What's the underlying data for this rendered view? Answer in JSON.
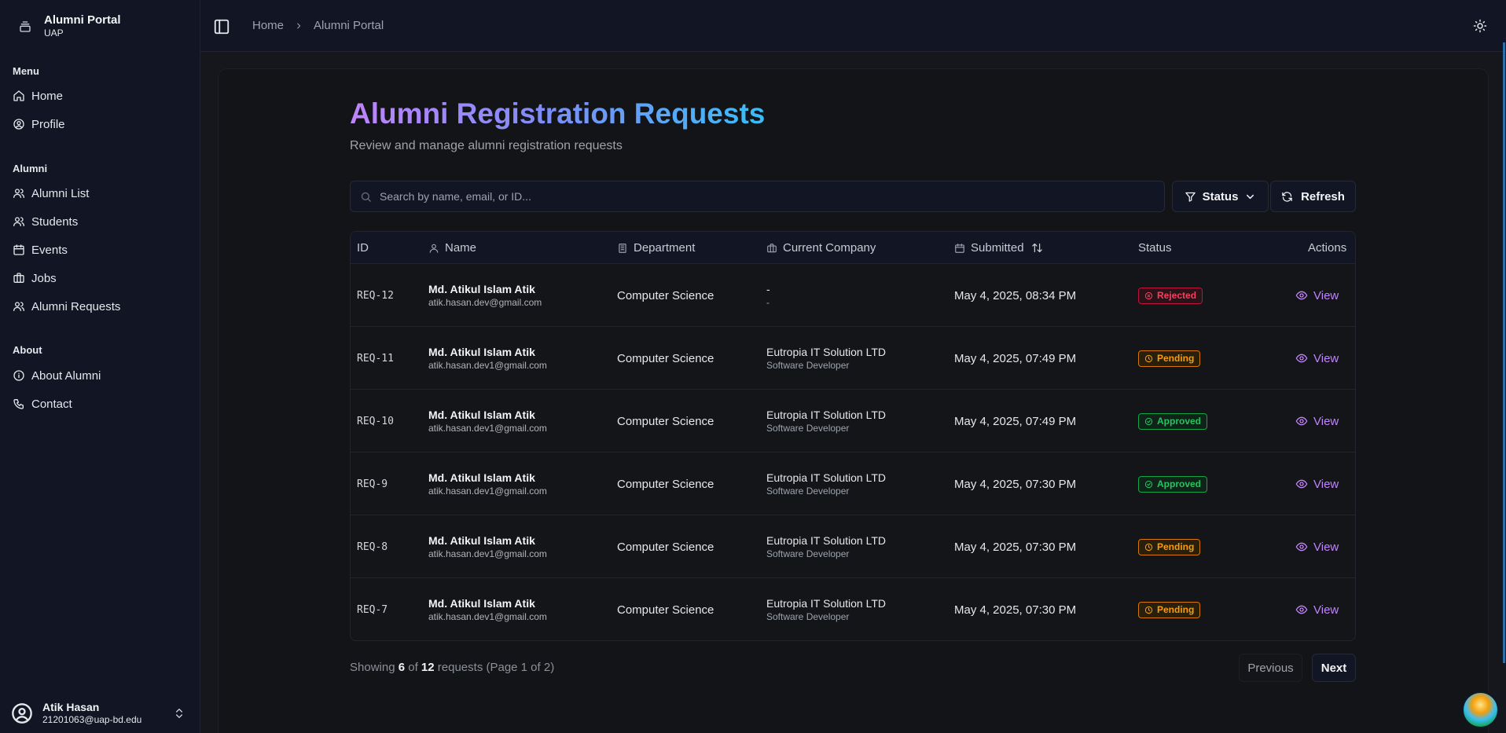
{
  "brand": {
    "title": "Alumni Portal",
    "subtitle": "UAP"
  },
  "sidebar": {
    "groups": [
      {
        "label": "Menu",
        "items": [
          {
            "label": "Home",
            "icon": "home-icon"
          },
          {
            "label": "Profile",
            "icon": "user-circle-icon"
          }
        ]
      },
      {
        "label": "Alumni",
        "items": [
          {
            "label": "Alumni List",
            "icon": "users-icon"
          },
          {
            "label": "Students",
            "icon": "users-icon"
          },
          {
            "label": "Events",
            "icon": "calendar-icon"
          },
          {
            "label": "Jobs",
            "icon": "briefcase-icon"
          },
          {
            "label": "Alumni Requests",
            "icon": "users-icon"
          }
        ]
      },
      {
        "label": "About",
        "items": [
          {
            "label": "About Alumni",
            "icon": "info-icon"
          },
          {
            "label": "Contact",
            "icon": "phone-icon"
          }
        ]
      }
    ],
    "user": {
      "name": "Atik Hasan",
      "email": "21201063@uap-bd.edu"
    }
  },
  "header": {
    "breadcrumb": [
      "Home",
      "Alumni Portal"
    ]
  },
  "page": {
    "title": "Alumni Registration Requests",
    "subtitle": "Review and manage alumni registration requests",
    "search_placeholder": "Search by name, email, or ID...",
    "status_button": "Status",
    "refresh_button": "Refresh"
  },
  "table": {
    "columns": [
      "ID",
      "Name",
      "Department",
      "Current Company",
      "Submitted",
      "Status",
      "Actions"
    ],
    "action_label": "View",
    "rows": [
      {
        "id": "REQ-12",
        "name": "Md. Atikul Islam Atik",
        "email": "atik.hasan.dev@gmail.com",
        "department": "Computer Science",
        "company": "-",
        "position": "-",
        "submitted": "May 4, 2025, 08:34 PM",
        "status": "Rejected"
      },
      {
        "id": "REQ-11",
        "name": "Md. Atikul Islam Atik",
        "email": "atik.hasan.dev1@gmail.com",
        "department": "Computer Science",
        "company": "Eutropia IT Solution LTD",
        "position": "Software Developer",
        "submitted": "May 4, 2025, 07:49 PM",
        "status": "Pending"
      },
      {
        "id": "REQ-10",
        "name": "Md. Atikul Islam Atik",
        "email": "atik.hasan.dev1@gmail.com",
        "department": "Computer Science",
        "company": "Eutropia IT Solution LTD",
        "position": "Software Developer",
        "submitted": "May 4, 2025, 07:49 PM",
        "status": "Approved"
      },
      {
        "id": "REQ-9",
        "name": "Md. Atikul Islam Atik",
        "email": "atik.hasan.dev1@gmail.com",
        "department": "Computer Science",
        "company": "Eutropia IT Solution LTD",
        "position": "Software Developer",
        "submitted": "May 4, 2025, 07:30 PM",
        "status": "Approved"
      },
      {
        "id": "REQ-8",
        "name": "Md. Atikul Islam Atik",
        "email": "atik.hasan.dev1@gmail.com",
        "department": "Computer Science",
        "company": "Eutropia IT Solution LTD",
        "position": "Software Developer",
        "submitted": "May 4, 2025, 07:30 PM",
        "status": "Pending"
      },
      {
        "id": "REQ-7",
        "name": "Md. Atikul Islam Atik",
        "email": "atik.hasan.dev1@gmail.com",
        "department": "Computer Science",
        "company": "Eutropia IT Solution LTD",
        "position": "Software Developer",
        "submitted": "May 4, 2025, 07:30 PM",
        "status": "Pending"
      }
    ]
  },
  "status_styles": {
    "Rejected": {
      "color": "#f43f5e",
      "bg": "#2a1218",
      "border": "#be123c",
      "icon": "x-circle-icon"
    },
    "Pending": {
      "color": "#f59e0b",
      "bg": "#2a1f0c",
      "border": "#d97706",
      "icon": "clock-icon"
    },
    "Approved": {
      "color": "#22c55e",
      "bg": "#0f2418",
      "border": "#16a34a",
      "icon": "check-circle-icon"
    }
  },
  "footer": {
    "showing_prefix": "Showing",
    "shown": "6",
    "of_word": "of",
    "total": "12",
    "suffix": "requests (Page 1 of 2)",
    "previous": "Previous",
    "next": "Next"
  }
}
